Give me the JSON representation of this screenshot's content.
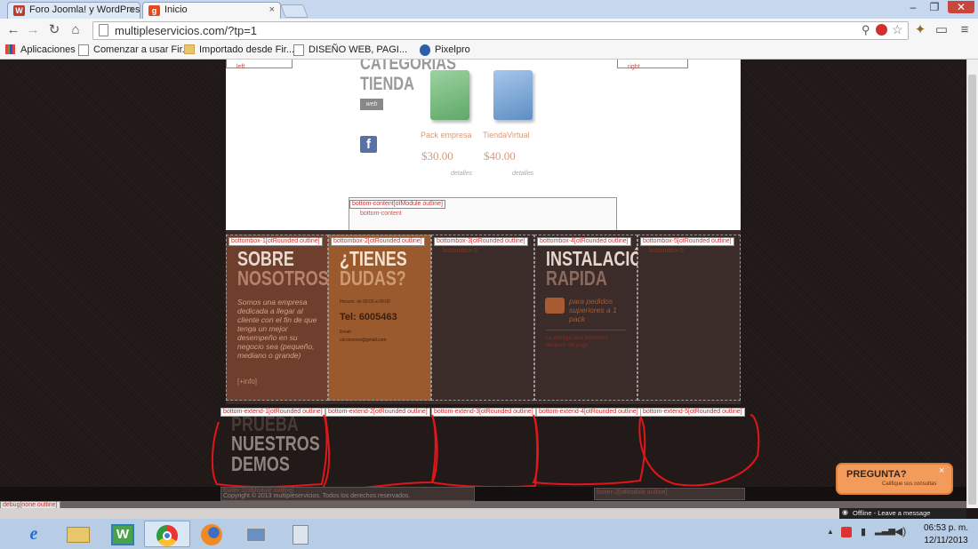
{
  "browser": {
    "tabs": [
      {
        "label": "Foro Joomla! y WordPress",
        "active": false
      },
      {
        "label": "Inicio",
        "active": true
      }
    ],
    "url": "multipleservicios.com/?tp=1",
    "bookmarks": [
      "Aplicaciones",
      "Comenzar a usar Fir...",
      "Importado desde Fir...",
      "DISEÑO WEB, PAGI...",
      "Pixelpro"
    ]
  },
  "page": {
    "left_label": "left",
    "right_label": "right",
    "category": {
      "line1": "CATEGORIAS",
      "line2": "TIENDA",
      "badge": "web"
    },
    "products": [
      {
        "name": "Pack empresa",
        "price": "$30.00",
        "details": "detalles"
      },
      {
        "name": "TiendaVirtual",
        "price": "$40.00",
        "details": "detalles"
      }
    ],
    "bottom_content": {
      "tag": "bottom-content[otModule outline]",
      "label": "bottom-content"
    },
    "bottombox": [
      {
        "tag": "bottombox-1[otRounded outline]",
        "title1": "SOBRE",
        "title2": "NOSOTROS",
        "text": "Somos una empresa dedicada a llegar al cliente con el fin de que tenga un mejor desempeño en su negocio sea (pequeño, mediano o grande)",
        "more": "[+info]"
      },
      {
        "tag": "bottombox-2[otRounded outline]",
        "title1": "¿TIENES",
        "title2": "DUDAS?",
        "hours": "Horario: de 09:00 a 09:00",
        "phone": "Tel: 6005463",
        "email_label": "Email:",
        "email": "corcicorreo@gmail.com"
      },
      {
        "tag": "bottombox-3[otRounded outline]",
        "sub": "bottombox-3"
      },
      {
        "tag": "bottombox-4[otRounded outline]",
        "title1": "INSTALACIÓN",
        "title2": "RAPIDA",
        "promo": "para pedidos superiores a 1 pack",
        "note": "La entrega sera inmediata despues del pago"
      },
      {
        "tag": "bottombox-5[otRounded outline]",
        "sub": "bottombox-5"
      }
    ],
    "extend": [
      {
        "tag": "bottom-extend-1[otRounded outline]"
      },
      {
        "tag": "bottom-extend-2[otRounded outline]"
      },
      {
        "tag": "bottom-extend-3[otRounded outline]"
      },
      {
        "tag": "bottom-extend-4[otRounded outline]"
      },
      {
        "tag": "bottom-extend-5[otRounded outline]"
      }
    ],
    "demos": {
      "line1": "PRUEBA",
      "line2": "NUESTROS",
      "line3": "DEMOS"
    },
    "footer": {
      "copyright": "Copyright © 2013 multipleservicios. Todos los derechos reservados.",
      "left_tag": "footer-1[otModule outline]",
      "right_tag": "footer-2[otModule outline]",
      "corner": "debug[none outline]"
    },
    "chat": {
      "title": "PREGUNTA?",
      "subtitle": "Califique sus consultas",
      "close": "×",
      "bar": "Offline - Leave a message"
    }
  },
  "taskbar": {
    "time": "06:53 p. m.",
    "date": "12/11/2013"
  },
  "colors": {
    "accent": "#c0602e",
    "box1": "#6b3a2a",
    "box2": "#9c5a2e",
    "box_dark": "#3a2b28",
    "chat": "#f29b5b"
  }
}
